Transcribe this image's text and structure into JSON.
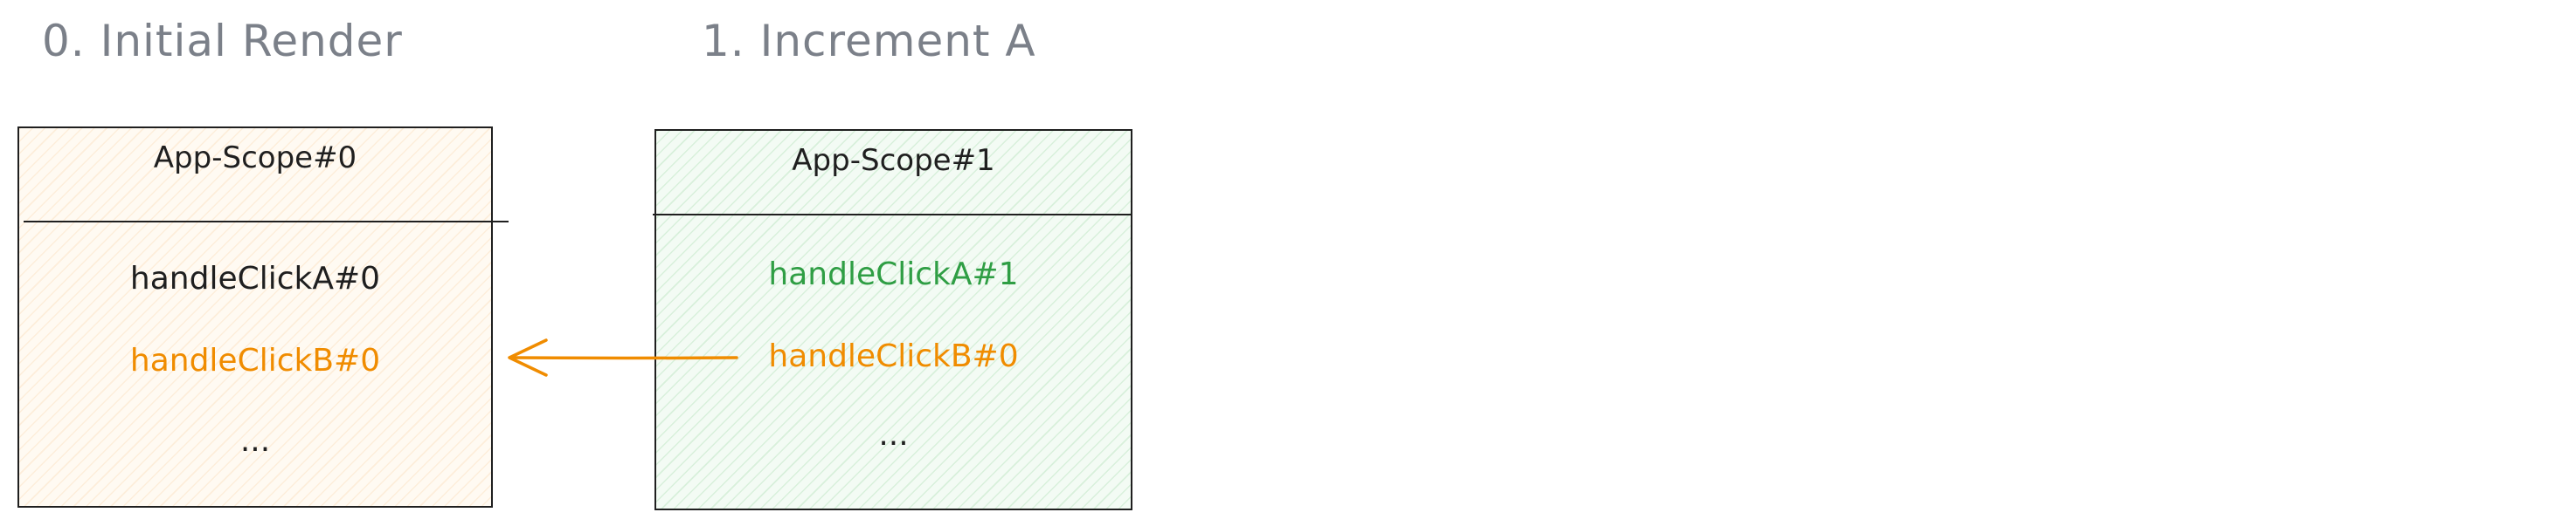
{
  "steps": [
    {
      "title": "0. Initial Render",
      "scope_label": "App-Scope#0",
      "items": [
        {
          "label": "handleClickA#0",
          "color": "#1f1f1f"
        },
        {
          "label": "handleClickB#0",
          "color": "#f08c00"
        },
        {
          "label": "...",
          "color": "#1f1f1f"
        }
      ]
    },
    {
      "title": "1. Increment A",
      "scope_label": "App-Scope#1",
      "items": [
        {
          "label": "handleClickA#1",
          "color": "#2f9e44"
        },
        {
          "label": "handleClickB#0",
          "color": "#f08c00"
        },
        {
          "label": "...",
          "color": "#1f1f1f"
        }
      ]
    }
  ],
  "colors": {
    "title_gray": "#7b8089",
    "border": "#1f1f1f",
    "reuse_orange": "#f08c00",
    "new_green": "#2f9e44",
    "box0_fill": "#fffaf2",
    "box1_fill": "#f3fbf4"
  },
  "arrow": {
    "from": "steps.1.items.1",
    "to": "steps.0.items.1",
    "color": "#f08c00"
  }
}
